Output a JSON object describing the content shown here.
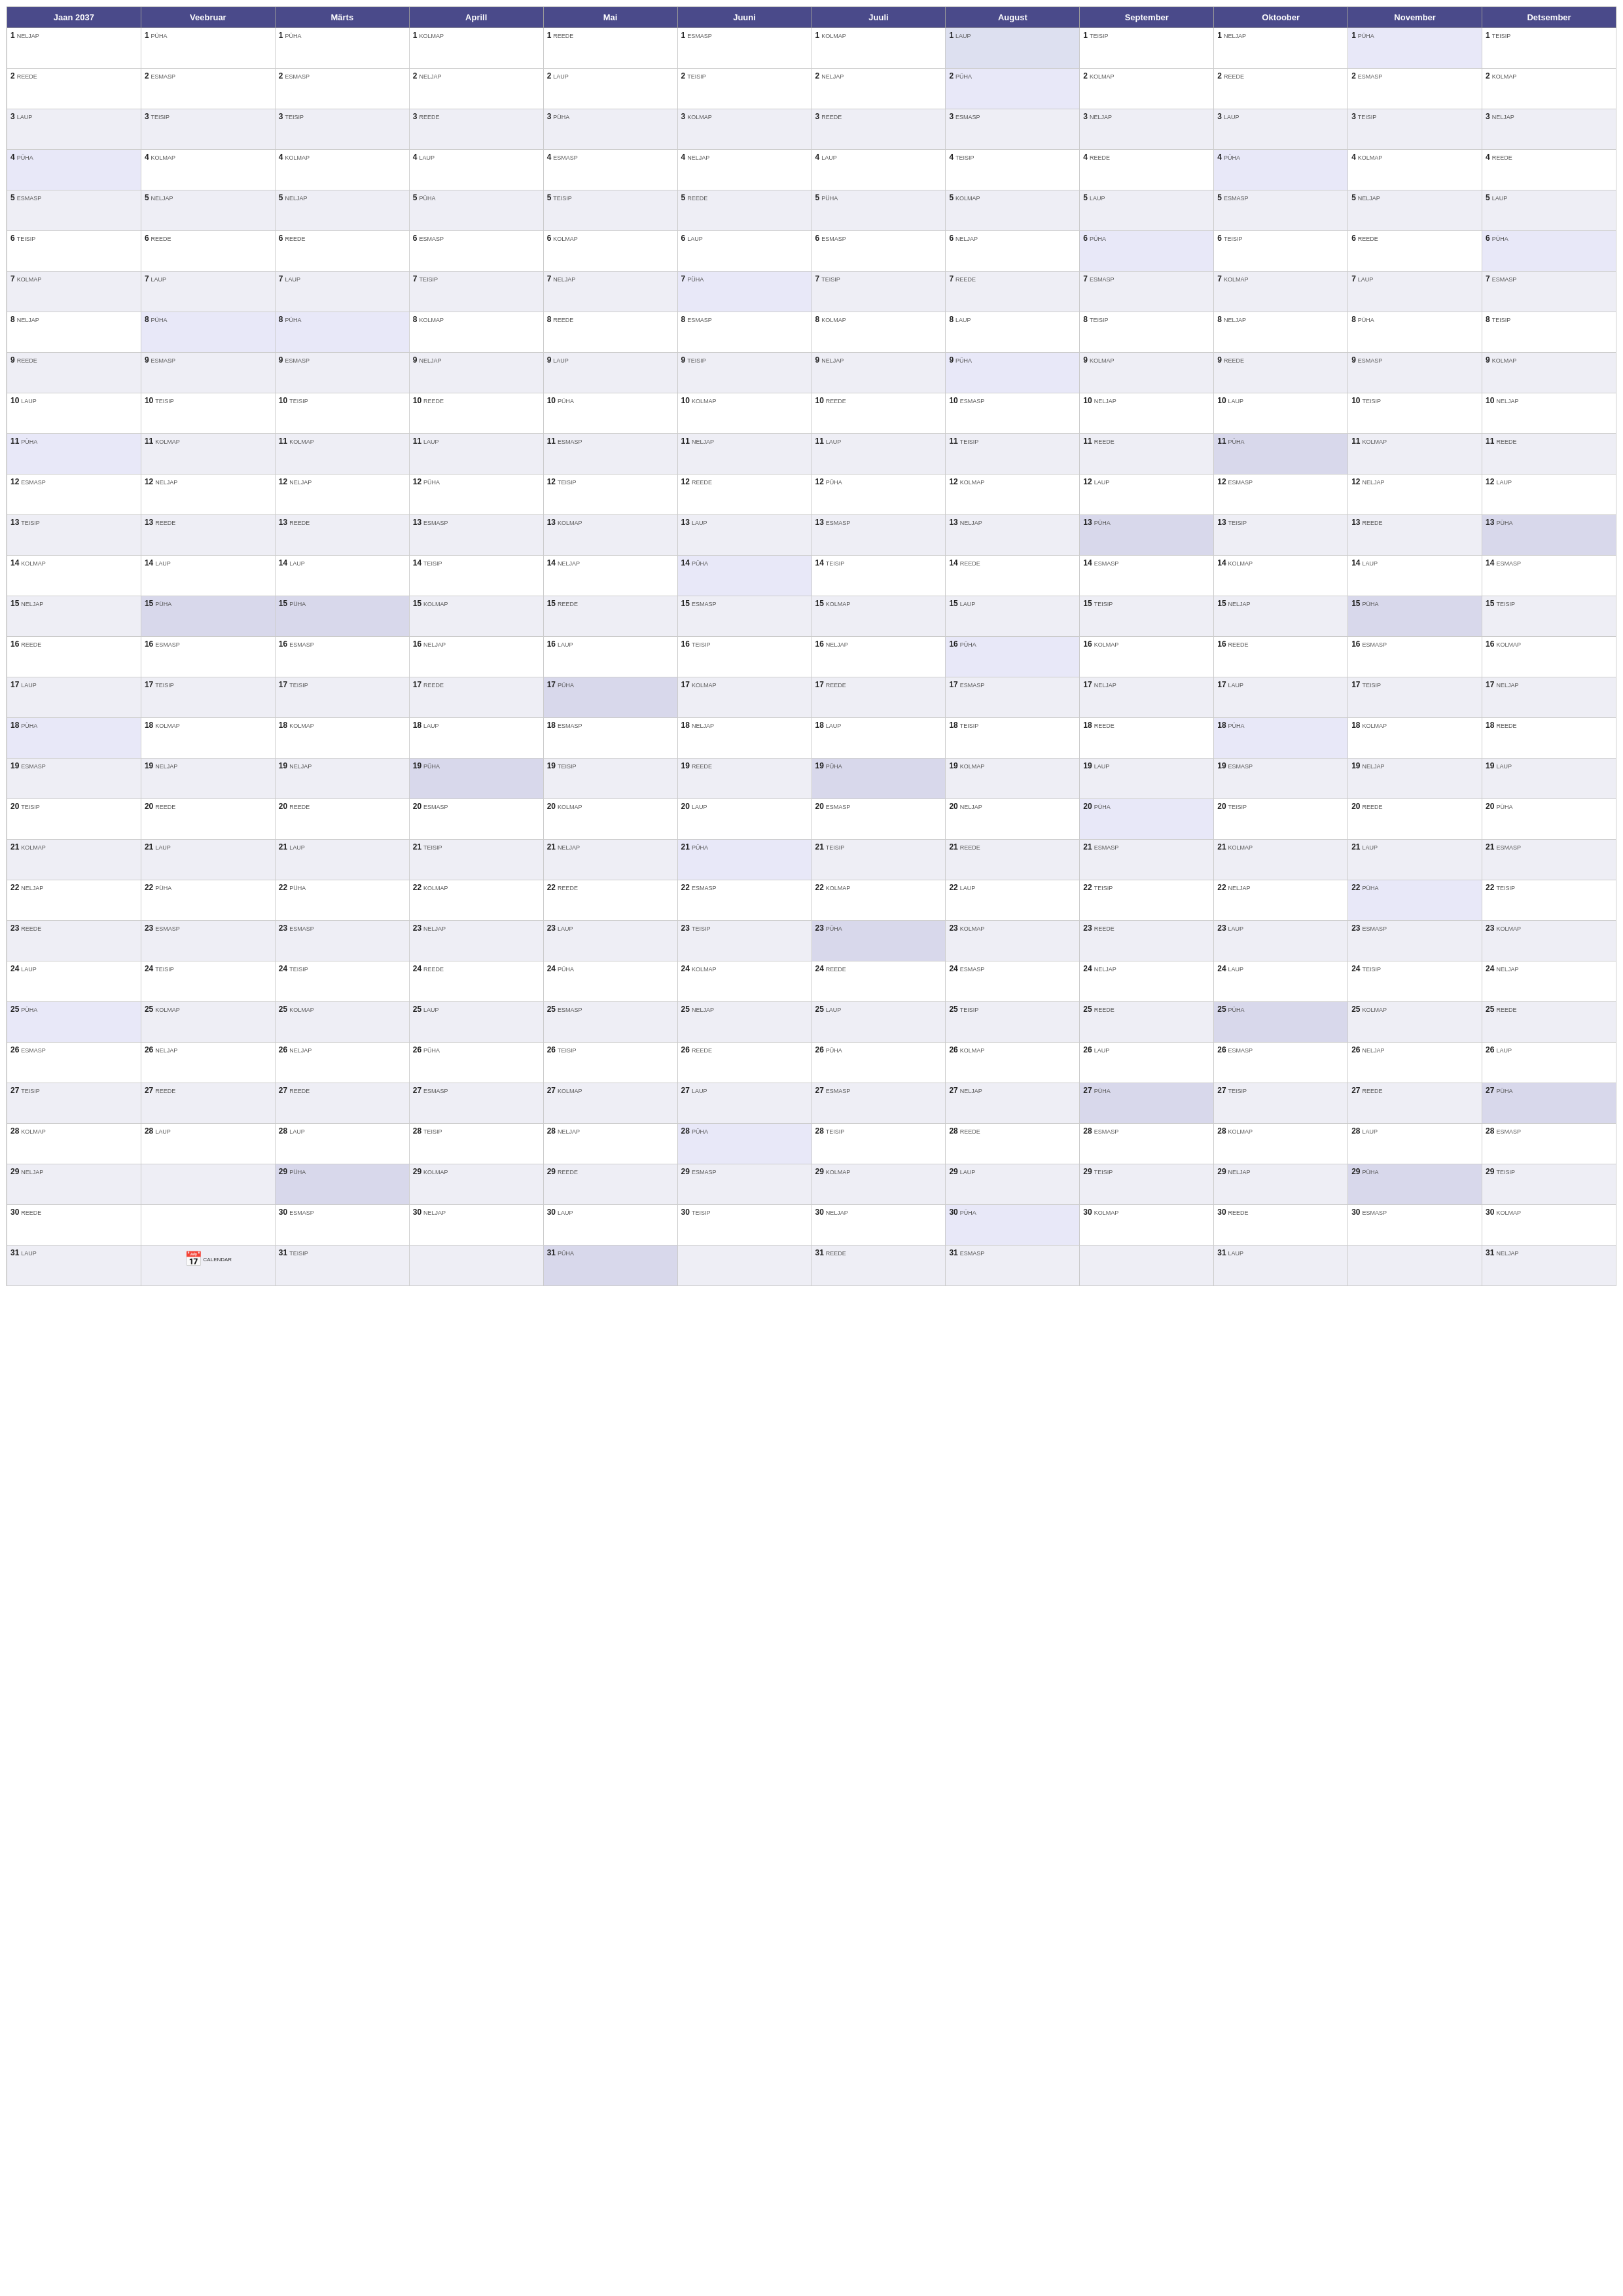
{
  "title": "Jaan 2037",
  "months": [
    "Jaan 2037",
    "Veebruar",
    "Märts",
    "Aprill",
    "Mai",
    "Juuni",
    "Juuli",
    "August",
    "September",
    "Oktoober",
    "November",
    "Detsember"
  ],
  "days": {
    "NELJAP": "NELJAP",
    "PÜHA": "PÜHA",
    "TEISIP": "TEISIP",
    "KOLMAP": "KOLMAP",
    "REEDE": "REEDE",
    "LAUP": "LAUP",
    "ESMASP": "ESMASP"
  },
  "calendar_data": [
    {
      "row": 1,
      "cells": [
        {
          "month": 0,
          "day": 1,
          "dayname": "NELJAP"
        },
        {
          "month": 1,
          "day": 1,
          "dayname": "PÜHA"
        },
        {
          "month": 2,
          "day": 1,
          "dayname": "PÜHA"
        },
        {
          "month": 3,
          "day": 1,
          "dayname": "KOLMAP"
        },
        {
          "month": 4,
          "day": 1,
          "dayname": "REEDE"
        },
        {
          "month": 5,
          "day": 1,
          "dayname": "ESMASP"
        },
        {
          "month": 6,
          "day": 1,
          "dayname": "KOLMAP"
        },
        {
          "month": 7,
          "day": 1,
          "dayname": "LAUP"
        },
        {
          "month": 8,
          "day": 1,
          "dayname": "TEISIP"
        },
        {
          "month": 9,
          "day": 1,
          "dayname": "NELJAP"
        },
        {
          "month": 10,
          "day": 1,
          "dayname": "PÜHA"
        },
        {
          "month": 11,
          "day": 1,
          "dayname": "TEISIP"
        }
      ]
    }
  ],
  "bottom_label": "7 CALENDAR"
}
